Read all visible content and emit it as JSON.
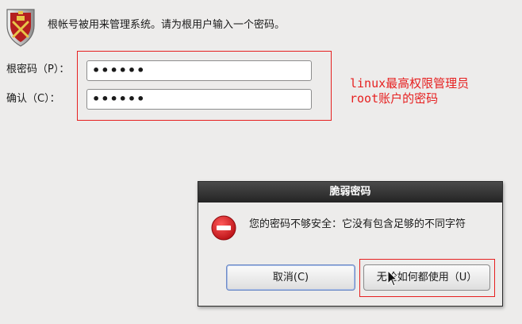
{
  "header": {
    "intro_text": "根帐号被用来管理系统。请为根用户输入一个密码。",
    "icon": "shield-emblem-icon"
  },
  "form": {
    "root_password": {
      "label": "根密码（P）：",
      "value": "••••••"
    },
    "confirm_password": {
      "label": "确认（C）：",
      "value": "••••••"
    }
  },
  "annotation": {
    "note": "linux最高权限管理员\nroot账户的密码",
    "color": "#e62020"
  },
  "dialog": {
    "title": "脆弱密码",
    "message": "您的密码不够安全：它没有包含足够的不同字符",
    "icon": "error-icon",
    "cancel_label": "取消(C)",
    "use_anyway_label": "无论如何都使用（U）"
  },
  "colors": {
    "background": "#edeceb",
    "titlebar": "#2e2e2e",
    "error_red": "#d8161b",
    "focus_blue": "#6d8ac6"
  }
}
